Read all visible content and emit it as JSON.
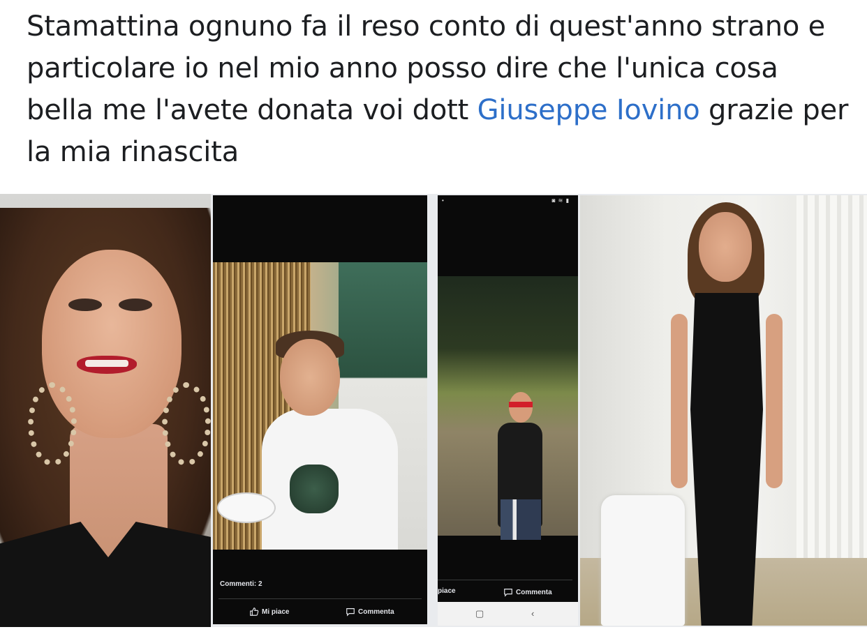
{
  "post": {
    "text_before": "Stamattina ognuno fa il reso conto di quest'anno strano e particolare io nel mio anno posso dire che l'unica cosa bella me l'avete donata voi dott ",
    "mention": "Giuseppe Iovino",
    "text_after": " grazie per la mia rinascita"
  },
  "photos": {
    "screenshot_1": {
      "comments_label": "Commenti: 2",
      "like_label": "Mi piace",
      "comment_label": "Commenta"
    },
    "screenshot_2": {
      "like_label": "piace",
      "comment_label": "Commenta",
      "nav_home": "▢",
      "nav_back": "‹"
    }
  },
  "colors": {
    "mention": "#2d6fc9",
    "text": "#1c1e21"
  }
}
